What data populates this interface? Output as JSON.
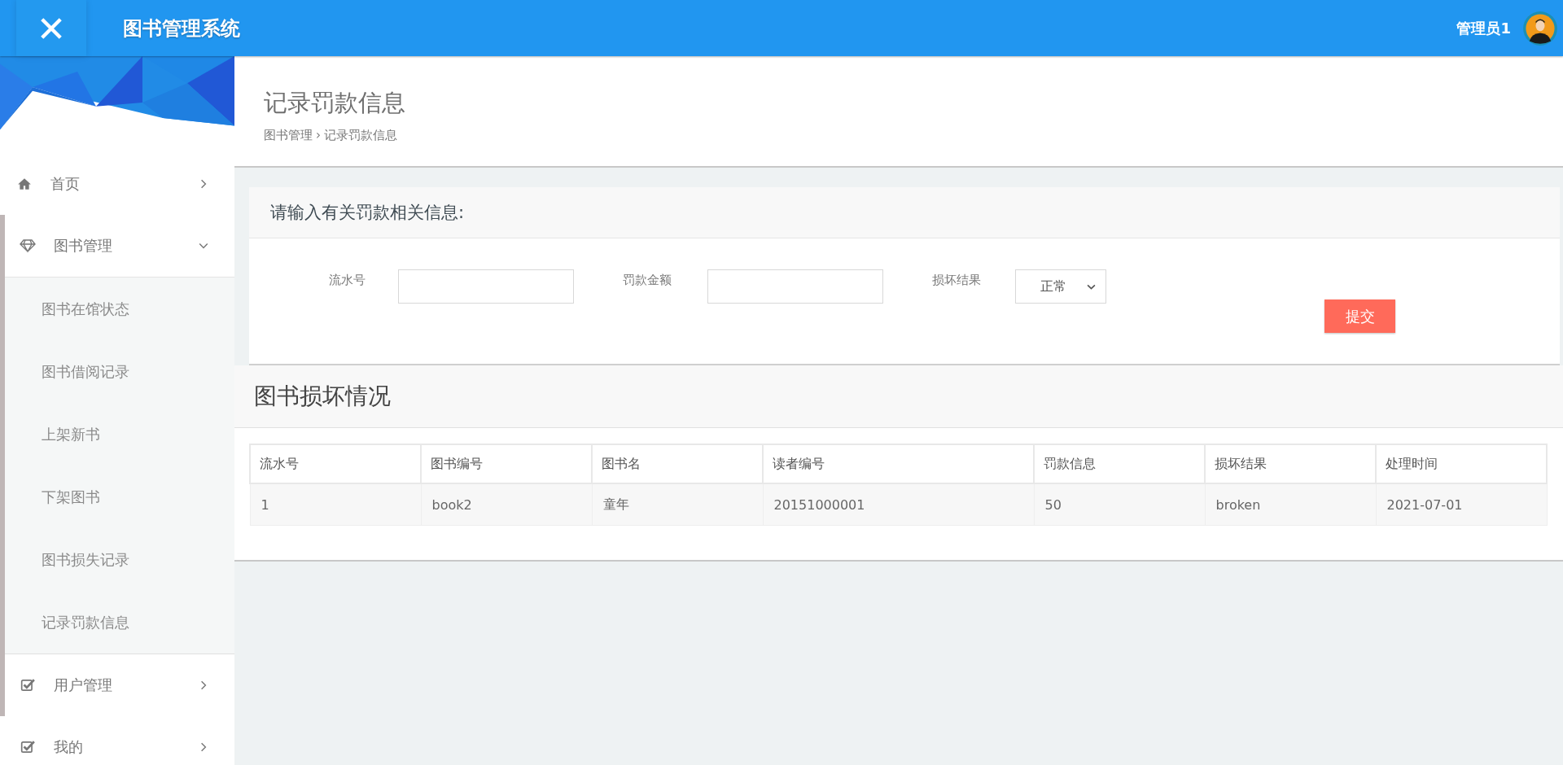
{
  "header": {
    "title": "图书管理系统",
    "user": "管理员1"
  },
  "sidebar": {
    "items": [
      {
        "label": "首页",
        "expanded": false
      },
      {
        "label": "图书管理",
        "expanded": true,
        "children": [
          {
            "label": "图书在馆状态"
          },
          {
            "label": "图书借阅记录"
          },
          {
            "label": "上架新书"
          },
          {
            "label": "下架图书"
          },
          {
            "label": "图书损失记录"
          },
          {
            "label": "记录罚款信息"
          }
        ]
      },
      {
        "label": "用户管理",
        "expanded": false
      },
      {
        "label": "我的",
        "expanded": false
      }
    ]
  },
  "page": {
    "title": "记录罚款信息",
    "breadcrumb": [
      "图书管理",
      "记录罚款信息"
    ],
    "separator": "›"
  },
  "form": {
    "title": "请输入有关罚款相关信息:",
    "fields": [
      {
        "label": "流水号",
        "kind": "text"
      },
      {
        "label": "罚款金额",
        "kind": "text"
      },
      {
        "label": "损坏结果",
        "kind": "select",
        "value": "正常"
      }
    ],
    "submit": "提交"
  },
  "table": {
    "title": "图书损坏情况",
    "columns": [
      "流水号",
      "图书编号",
      "图书名",
      "读者编号",
      "罚款信息",
      "损坏结果",
      "处理时间"
    ],
    "rows": [
      [
        "1",
        "book2",
        "童年",
        "20151000001",
        "50",
        "broken",
        "2021-07-01"
      ]
    ]
  }
}
